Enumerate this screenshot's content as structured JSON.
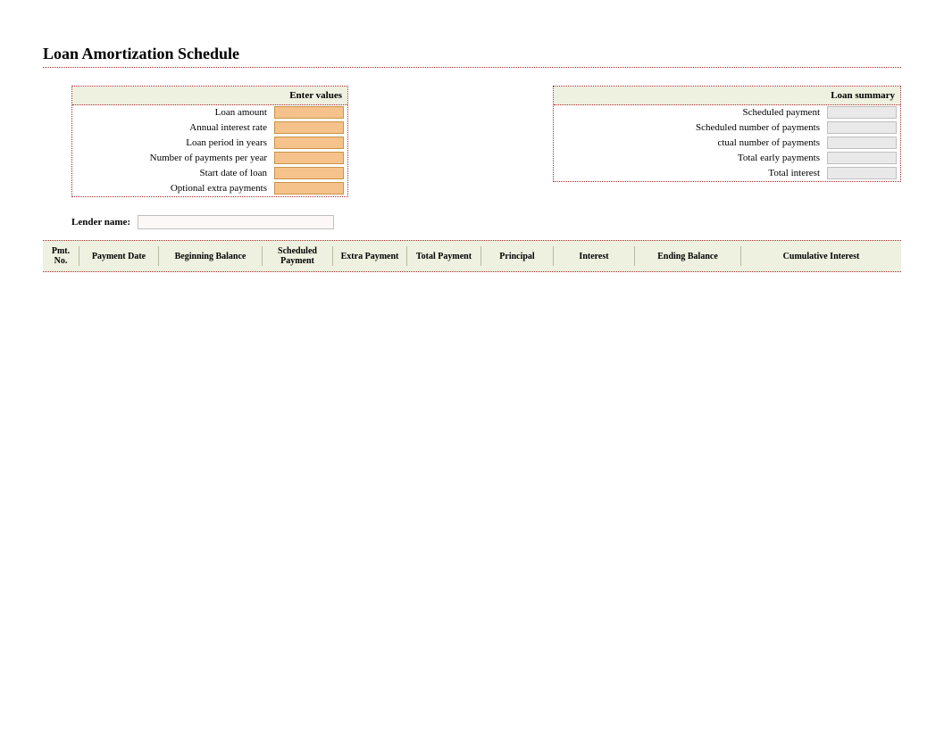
{
  "title": "Loan Amortization Schedule",
  "enter_values": {
    "header": "Enter values",
    "rows": [
      {
        "label": "Loan amount",
        "value": ""
      },
      {
        "label": "Annual interest rate",
        "value": ""
      },
      {
        "label": "Loan period in years",
        "value": ""
      },
      {
        "label": "Number of payments per year",
        "value": ""
      },
      {
        "label": "Start date of loan",
        "value": ""
      },
      {
        "label": "Optional extra payments",
        "value": ""
      }
    ]
  },
  "loan_summary": {
    "header": "Loan summary",
    "rows": [
      {
        "label": "Scheduled payment",
        "value": ""
      },
      {
        "label": "Scheduled number of payments",
        "value": ""
      },
      {
        "label": "ctual number of payments",
        "value": ""
      },
      {
        "label": "Total early payments",
        "value": ""
      },
      {
        "label": "Total interest",
        "value": ""
      }
    ]
  },
  "lender": {
    "label": "Lender name:",
    "value": ""
  },
  "columns": [
    "Pmt. No.",
    "Payment Date",
    "Beginning Balance",
    "Scheduled Payment",
    "Extra Payment",
    "Total Payment",
    "Principal",
    "Interest",
    "Ending Balance",
    "Cumulative Interest"
  ]
}
